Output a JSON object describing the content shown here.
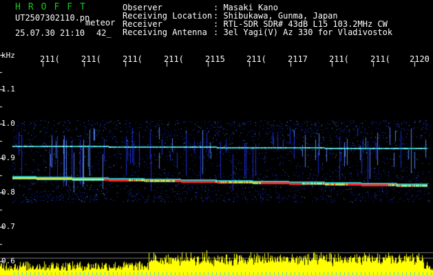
{
  "header": {
    "brand": "HROFFT",
    "filename": "UT2507302110.pn",
    "kind": "meteor",
    "timestamp": "25.07.30 21:10",
    "count": "42_",
    "info_labels": [
      "Observer",
      "Receiving Location",
      "Receiver",
      "Receiving Antenna"
    ],
    "info_values": [
      ": Masaki Kano",
      ": Shibukawa, Gunma, Japan",
      ": RTL-SDR SDR# 43dB L15 103.2MHz CW",
      ": 3el Yagi(V) Az 330 for Vladivostok"
    ]
  },
  "axis": {
    "y_unit": "kHz",
    "x_ticks": [
      "211(",
      "211(",
      "211(",
      "211(",
      "2115",
      "211(",
      "2117",
      "211(",
      "211(",
      "2120"
    ],
    "y_ticks": [
      "1.1",
      "1.0",
      "0.9",
      "0.8",
      "0.7",
      "0.6"
    ]
  },
  "colors": {
    "background": "#000000",
    "brand": "#1ec81e",
    "signal_low": "#1a2bd6",
    "signal_mid": "#28c8c8",
    "signal_high": "#ff2a2a",
    "amplitude": "#ffff00"
  }
}
